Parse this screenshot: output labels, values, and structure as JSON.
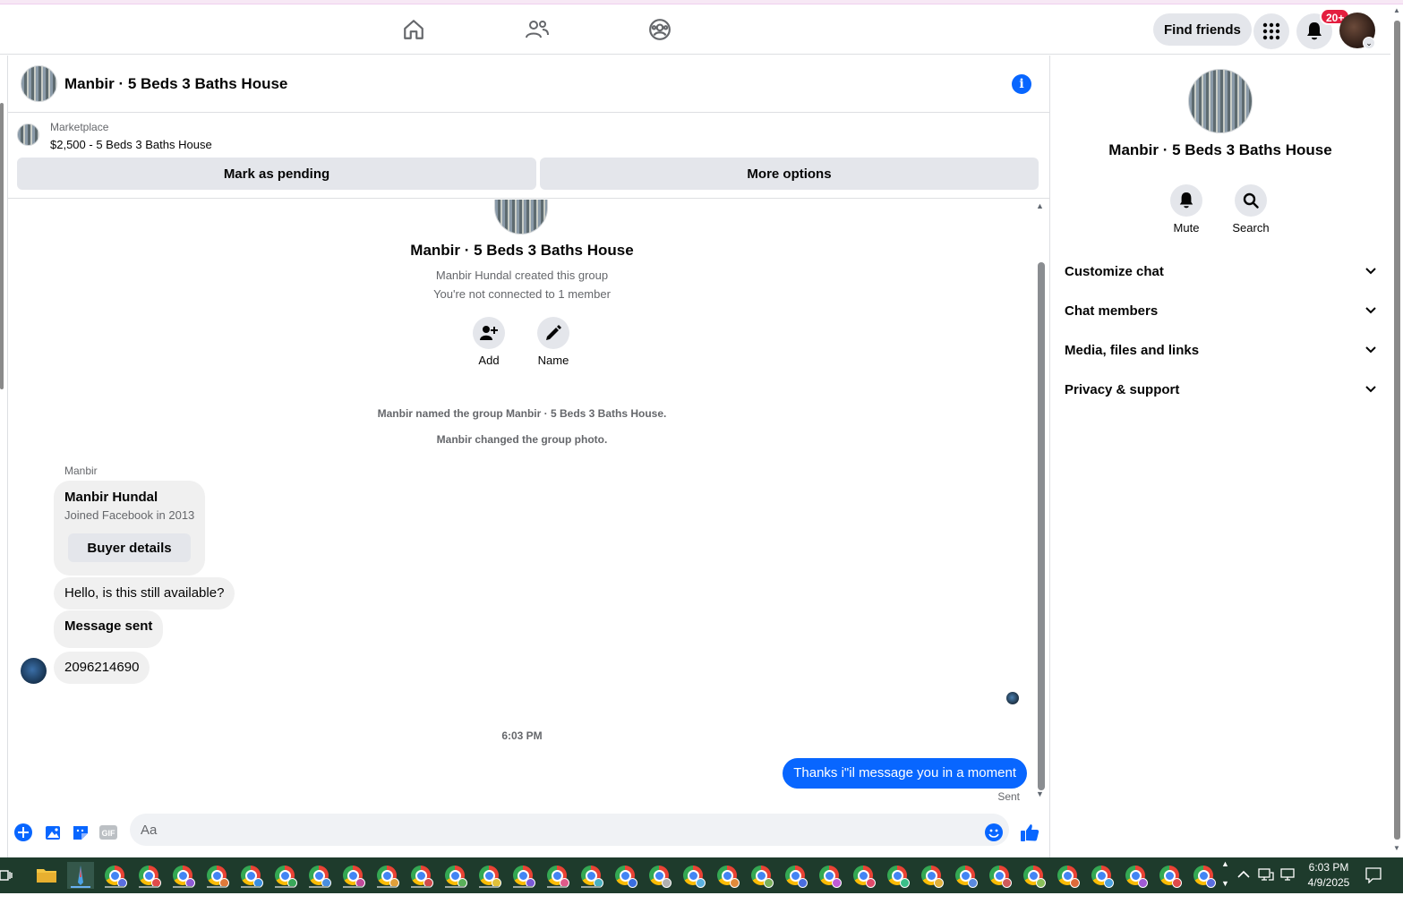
{
  "topbar": {
    "find_friends": "Find friends",
    "notification_count": "20+",
    "nav_icons": [
      "home-icon",
      "friends-icon",
      "groups-icon"
    ]
  },
  "chat": {
    "header_title": "Manbir · 5 Beds 3 Baths House",
    "marketplace_label": "Marketplace",
    "listing_title": "$2,500 - 5 Beds 3 Baths House",
    "mark_pending": "Mark as pending",
    "more_options": "More options"
  },
  "thread": {
    "title": "Manbir · 5 Beds 3 Baths House",
    "created_by": "Manbir Hundal created this group",
    "not_connected": "You're not connected to 1 member",
    "add_label": "Add",
    "name_label": "Name",
    "sys_named": "Manbir named the group Manbir · 5 Beds 3 Baths House.",
    "sys_photo": "Manbir changed the group photo.",
    "sender": "Manbir",
    "card_name": "Manbir Hundal",
    "card_sub": "Joined Facebook in 2013",
    "card_button": "Buyer details",
    "msg_available": "Hello, is this still available?",
    "msg_sent": "Message sent",
    "msg_phone": "2096214690",
    "time": "6:03 PM",
    "my_message": "Thanks i\"il message you in a moment",
    "sent_status": "Sent"
  },
  "composer": {
    "placeholder": "Aa"
  },
  "right_panel": {
    "title": "Manbir · 5 Beds 3 Baths House",
    "mute": "Mute",
    "search": "Search",
    "sections": [
      "Customize chat",
      "Chat members",
      "Media, files and links",
      "Privacy & support"
    ]
  },
  "taskbar": {
    "time": "6:03 PM",
    "date": "4/9/2025"
  },
  "colors": {
    "accent": "#0866ff",
    "badge": "#e41e3f",
    "bubble_gray": "#f0f0f0",
    "taskbar": "#1e3b2c"
  }
}
